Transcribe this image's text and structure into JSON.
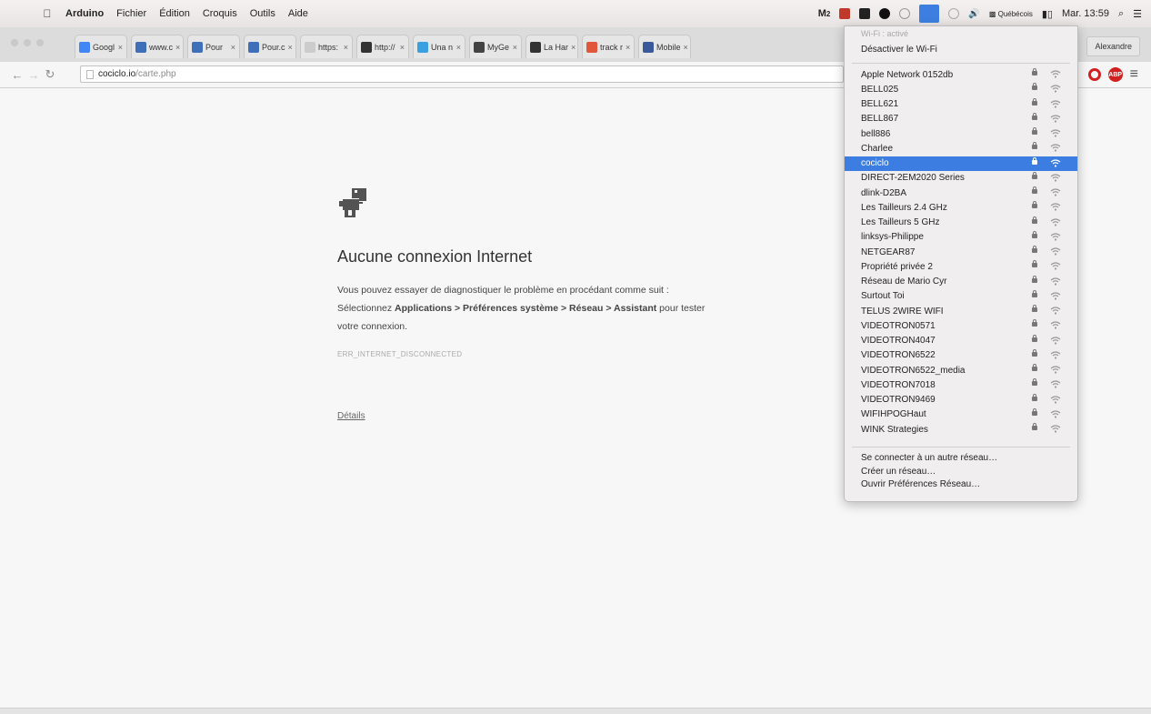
{
  "menubar": {
    "app_name": "Arduino",
    "items": [
      "Fichier",
      "Édition",
      "Croquis",
      "Outils",
      "Aide"
    ],
    "status_right": {
      "m_label": "M",
      "m_count": "2",
      "input_source": "Québécois",
      "clock": "Mar. 13:59"
    }
  },
  "tabs": [
    {
      "label": "Googl",
      "color": "#4285f4"
    },
    {
      "label": "www.c",
      "color": "#3f6fb8"
    },
    {
      "label": "Pour ",
      "color": "#3f6fb8"
    },
    {
      "label": "Pour.c",
      "color": "#3f6fb8"
    },
    {
      "label": "https:",
      "color": "#cccccc"
    },
    {
      "label": "http://",
      "color": "#333333"
    },
    {
      "label": "Una n",
      "color": "#3aa0e0"
    },
    {
      "label": "MyGe",
      "color": "#444444"
    },
    {
      "label": "La Har",
      "color": "#333333"
    },
    {
      "label": "track r",
      "color": "#e0573a"
    },
    {
      "label": "Mobile",
      "color": "#3b5998"
    }
  ],
  "profile_name": "Alexandre",
  "address": {
    "host": "cociclo.io",
    "path": "/carte.php"
  },
  "error": {
    "title": "Aucune connexion Internet",
    "line1": "Vous pouvez essayer de diagnostiquer le problème en procédant comme suit :",
    "line2_prefix": "Sélectionnez ",
    "line2_bold": "Applications > Préférences système > Réseau > Assistant",
    "line2_suffix": " pour tester",
    "line3": "votre connexion.",
    "code": "ERR_INTERNET_DISCONNECTED",
    "details_link": "Détails"
  },
  "wifi_menu": {
    "status": "Wi-Fi : activé",
    "toggle": "Désactiver le Wi-Fi",
    "networks": [
      {
        "name": "Apple Network 0152db",
        "selected": false
      },
      {
        "name": "BELL025",
        "selected": false
      },
      {
        "name": "BELL621",
        "selected": false
      },
      {
        "name": "BELL867",
        "selected": false
      },
      {
        "name": "bell886",
        "selected": false
      },
      {
        "name": "Charlee",
        "selected": false
      },
      {
        "name": "cociclo",
        "selected": true
      },
      {
        "name": "DIRECT-2EM2020 Series",
        "selected": false
      },
      {
        "name": "dlink-D2BA",
        "selected": false
      },
      {
        "name": "Les Tailleurs 2.4 GHz",
        "selected": false
      },
      {
        "name": "Les Tailleurs 5 GHz",
        "selected": false
      },
      {
        "name": "linksys-Philippe",
        "selected": false
      },
      {
        "name": "NETGEAR87",
        "selected": false
      },
      {
        "name": "Propriété privée 2",
        "selected": false
      },
      {
        "name": "Réseau de Mario Cyr",
        "selected": false
      },
      {
        "name": "Surtout Toi",
        "selected": false
      },
      {
        "name": "TELUS 2WIRE WIFI",
        "selected": false
      },
      {
        "name": "VIDEOTRON0571",
        "selected": false
      },
      {
        "name": "VIDEOTRON4047",
        "selected": false
      },
      {
        "name": "VIDEOTRON6522",
        "selected": false
      },
      {
        "name": "VIDEOTRON6522_media",
        "selected": false
      },
      {
        "name": "VIDEOTRON7018",
        "selected": false
      },
      {
        "name": "VIDEOTRON9469",
        "selected": false
      },
      {
        "name": "WIFIHPOGHaut",
        "selected": false
      },
      {
        "name": "WINK Strategies",
        "selected": false
      }
    ],
    "actions": [
      "Se connecter à un autre réseau…",
      "Créer un réseau…",
      "Ouvrir Préférences Réseau…"
    ]
  },
  "colors": {
    "selection": "#3b7de0",
    "opera_red": "#d21f1f"
  }
}
